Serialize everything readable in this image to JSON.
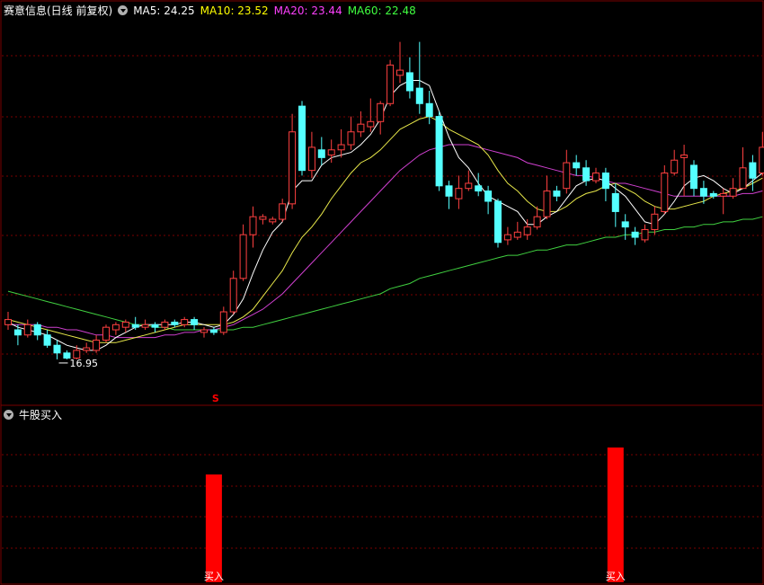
{
  "header": {
    "title": "赛意信息(日线 前复权)",
    "ma": [
      {
        "label": "MA5: 24.25",
        "color": "#ffffff"
      },
      {
        "label": "MA10: 23.52",
        "color": "#ffff00"
      },
      {
        "label": "MA20: 23.44",
        "color": "#ff40ff"
      },
      {
        "label": "MA60: 22.48",
        "color": "#40ff40"
      }
    ]
  },
  "colors": {
    "up": "#ff4040",
    "down": "#54ffff",
    "ma5": "#ffffff",
    "ma10": "#e8e84a",
    "ma20": "#d040d0",
    "ma60": "#40d040",
    "grid": "#7a0000",
    "signal": "#ff0000"
  },
  "indicator": {
    "title": "牛股买入",
    "signal_label": "买入",
    "marker": "S"
  },
  "chart_data": {
    "type": "candlestick",
    "price_range": [
      15.2,
      30.3
    ],
    "min_label": "16.95",
    "candles": [
      [
        18.3,
        18.5,
        18.8,
        18.1
      ],
      [
        18.1,
        17.9,
        18.3,
        17.5
      ],
      [
        17.9,
        18.3,
        18.5,
        17.8
      ],
      [
        18.3,
        17.9,
        18.4,
        17.7
      ],
      [
        17.9,
        17.5,
        18.1,
        17.4
      ],
      [
        17.5,
        17.2,
        17.7,
        16.95
      ],
      [
        17.2,
        17.0,
        17.3,
        16.95
      ],
      [
        17.0,
        17.3,
        17.5,
        16.95
      ],
      [
        17.3,
        17.4,
        17.6,
        17.2
      ],
      [
        17.3,
        17.7,
        17.9,
        17.2
      ],
      [
        17.7,
        18.2,
        18.3,
        17.6
      ],
      [
        18.1,
        18.3,
        18.4,
        17.9
      ],
      [
        18.2,
        18.4,
        18.5,
        18.0
      ],
      [
        18.3,
        18.2,
        18.6,
        18.1
      ],
      [
        18.2,
        18.3,
        18.5,
        18.1
      ],
      [
        18.3,
        18.2,
        18.4,
        18.0
      ],
      [
        18.2,
        18.4,
        18.5,
        18.1
      ],
      [
        18.4,
        18.3,
        18.5,
        18.2
      ],
      [
        18.3,
        18.5,
        18.6,
        18.2
      ],
      [
        18.5,
        18.3,
        18.6,
        18.1
      ],
      [
        18.0,
        18.1,
        18.2,
        17.8
      ],
      [
        18.1,
        18.0,
        18.2,
        17.9
      ],
      [
        18.0,
        18.8,
        19.0,
        17.9
      ],
      [
        18.8,
        20.1,
        20.4,
        18.7
      ],
      [
        20.1,
        21.8,
        22.2,
        20.0
      ],
      [
        21.8,
        22.5,
        22.9,
        21.3
      ],
      [
        22.4,
        22.5,
        22.6,
        22.2
      ],
      [
        22.3,
        22.4,
        22.5,
        22.2
      ],
      [
        22.4,
        23.0,
        23.2,
        22.3
      ],
      [
        23.0,
        25.8,
        26.5,
        22.8
      ],
      [
        26.8,
        24.3,
        27.0,
        24.1
      ],
      [
        24.3,
        25.2,
        25.8,
        24.0
      ],
      [
        25.1,
        24.8,
        25.6,
        24.5
      ],
      [
        24.9,
        25.1,
        25.5,
        24.6
      ],
      [
        25.1,
        25.3,
        25.9,
        24.8
      ],
      [
        25.3,
        25.8,
        26.4,
        25.1
      ],
      [
        25.8,
        26.1,
        26.6,
        25.6
      ],
      [
        26.0,
        26.2,
        27.1,
        25.8
      ],
      [
        26.2,
        26.9,
        27.0,
        25.7
      ],
      [
        26.9,
        28.4,
        28.6,
        26.8
      ],
      [
        28.0,
        28.2,
        29.3,
        27.7
      ],
      [
        28.1,
        27.4,
        28.7,
        27.1
      ],
      [
        27.5,
        26.9,
        29.3,
        26.5
      ],
      [
        26.9,
        26.4,
        27.4,
        26.1
      ],
      [
        26.4,
        23.7,
        26.6,
        23.5
      ],
      [
        23.7,
        23.3,
        23.9,
        22.8
      ],
      [
        23.2,
        23.6,
        24.1,
        22.8
      ],
      [
        23.6,
        23.8,
        24.3,
        23.5
      ],
      [
        23.7,
        23.5,
        24.2,
        23.3
      ],
      [
        23.5,
        23.1,
        23.7,
        22.6
      ],
      [
        23.1,
        21.5,
        23.2,
        21.3
      ],
      [
        21.6,
        21.8,
        22.1,
        21.4
      ],
      [
        21.7,
        21.9,
        22.3,
        21.6
      ],
      [
        21.8,
        22.1,
        22.4,
        21.6
      ],
      [
        22.1,
        22.5,
        22.9,
        22.0
      ],
      [
        22.5,
        23.5,
        24.1,
        22.4
      ],
      [
        23.5,
        23.3,
        23.7,
        23.1
      ],
      [
        23.6,
        24.6,
        25.1,
        23.4
      ],
      [
        24.6,
        24.4,
        24.9,
        24.1
      ],
      [
        24.4,
        23.9,
        24.7,
        23.7
      ],
      [
        23.9,
        24.2,
        24.4,
        23.8
      ],
      [
        24.2,
        23.6,
        24.4,
        23.1
      ],
      [
        23.4,
        22.7,
        23.8,
        22.1
      ],
      [
        22.3,
        22.1,
        22.6,
        21.6
      ],
      [
        21.9,
        21.7,
        22.1,
        21.4
      ],
      [
        21.6,
        22.0,
        22.2,
        21.5
      ],
      [
        22.0,
        22.6,
        22.9,
        21.8
      ],
      [
        22.7,
        24.2,
        24.5,
        22.6
      ],
      [
        24.2,
        24.7,
        25.1,
        24.1
      ],
      [
        24.8,
        24.9,
        25.3,
        23.3
      ],
      [
        24.5,
        23.6,
        24.7,
        23.3
      ],
      [
        23.6,
        23.3,
        23.9,
        23.0
      ],
      [
        23.4,
        23.3,
        23.5,
        23.2
      ],
      [
        23.3,
        23.4,
        23.6,
        22.6
      ],
      [
        23.3,
        23.6,
        24.0,
        23.2
      ],
      [
        23.6,
        24.4,
        25.2,
        23.6
      ],
      [
        24.6,
        24.0,
        24.9,
        23.5
      ],
      [
        24.2,
        25.2,
        25.8,
        24.1
      ]
    ],
    "ma5": [
      18.4,
      18.2,
      18.1,
      18.0,
      17.9,
      17.7,
      17.5,
      17.4,
      17.3,
      17.3,
      17.5,
      17.8,
      18.0,
      18.2,
      18.3,
      18.3,
      18.3,
      18.3,
      18.4,
      18.4,
      18.3,
      18.2,
      18.3,
      18.7,
      19.3,
      20.3,
      21.2,
      21.9,
      22.3,
      23.5,
      23.9,
      23.9,
      24.5,
      24.8,
      24.9,
      25.0,
      25.3,
      25.7,
      26.3,
      27.2,
      27.6,
      27.8,
      27.8,
      27.6,
      26.6,
      25.6,
      24.8,
      24.4,
      23.8,
      23.3,
      23.1,
      22.9,
      22.7,
      22.2,
      22.2,
      22.5,
      22.7,
      23.2,
      23.7,
      23.9,
      24.0,
      23.9,
      23.6,
      23.3,
      22.8,
      22.3,
      22.2,
      22.6,
      23.1,
      23.7,
      24.0,
      24.1,
      23.9,
      23.6,
      23.4,
      23.6,
      23.9,
      24.2
    ],
    "ma10": [
      18.5,
      18.4,
      18.3,
      18.2,
      18.1,
      18.0,
      17.9,
      17.8,
      17.7,
      17.6,
      17.6,
      17.6,
      17.7,
      17.8,
      17.9,
      18.0,
      18.1,
      18.2,
      18.3,
      18.3,
      18.3,
      18.3,
      18.3,
      18.4,
      18.6,
      18.9,
      19.4,
      19.9,
      20.4,
      21.1,
      21.7,
      22.1,
      22.6,
      23.2,
      23.7,
      24.2,
      24.6,
      24.8,
      25.1,
      25.5,
      25.9,
      26.1,
      26.3,
      26.4,
      26.2,
      25.9,
      25.7,
      25.5,
      25.3,
      24.9,
      24.3,
      23.8,
      23.5,
      23.1,
      22.8,
      22.7,
      22.7,
      22.9,
      23.2,
      23.4,
      23.5,
      23.7,
      23.8,
      23.6,
      23.4,
      23.1,
      22.9,
      22.8,
      22.8,
      22.9,
      23.0,
      23.1,
      23.3,
      23.4,
      23.5,
      23.6,
      23.8,
      24.0
    ],
    "ma20": [
      18.3,
      18.3,
      18.3,
      18.3,
      18.2,
      18.2,
      18.1,
      18.1,
      18.0,
      17.9,
      17.9,
      17.8,
      17.8,
      17.8,
      17.8,
      17.8,
      17.9,
      17.9,
      18.0,
      18.0,
      18.1,
      18.1,
      18.2,
      18.3,
      18.5,
      18.7,
      18.9,
      19.2,
      19.5,
      19.9,
      20.3,
      20.7,
      21.1,
      21.5,
      21.9,
      22.3,
      22.7,
      23.1,
      23.5,
      23.9,
      24.3,
      24.6,
      24.9,
      25.1,
      25.2,
      25.3,
      25.3,
      25.3,
      25.2,
      25.1,
      25.0,
      24.9,
      24.8,
      24.6,
      24.5,
      24.4,
      24.3,
      24.2,
      24.1,
      24.1,
      24.0,
      23.9,
      23.8,
      23.8,
      23.7,
      23.6,
      23.5,
      23.4,
      23.3,
      23.3,
      23.3,
      23.3,
      23.3,
      23.3,
      23.3,
      23.4,
      23.4,
      23.5
    ],
    "ma60": [
      19.6,
      19.5,
      19.4,
      19.3,
      19.2,
      19.1,
      19.0,
      18.9,
      18.8,
      18.7,
      18.6,
      18.5,
      18.4,
      18.3,
      18.3,
      18.2,
      18.2,
      18.1,
      18.1,
      18.1,
      18.1,
      18.1,
      18.1,
      18.1,
      18.2,
      18.2,
      18.3,
      18.4,
      18.5,
      18.6,
      18.7,
      18.8,
      18.9,
      19.0,
      19.1,
      19.2,
      19.3,
      19.4,
      19.5,
      19.7,
      19.8,
      19.9,
      20.1,
      20.2,
      20.3,
      20.4,
      20.5,
      20.6,
      20.7,
      20.8,
      20.9,
      21.0,
      21.0,
      21.1,
      21.2,
      21.2,
      21.3,
      21.4,
      21.4,
      21.5,
      21.6,
      21.7,
      21.7,
      21.8,
      21.8,
      21.9,
      21.9,
      22.0,
      22.0,
      22.1,
      22.1,
      22.2,
      22.2,
      22.3,
      22.3,
      22.4,
      22.4,
      22.5
    ],
    "signals": [
      {
        "index": 21,
        "value": 0.8
      },
      {
        "index": 62,
        "value": 1.0
      }
    ]
  }
}
